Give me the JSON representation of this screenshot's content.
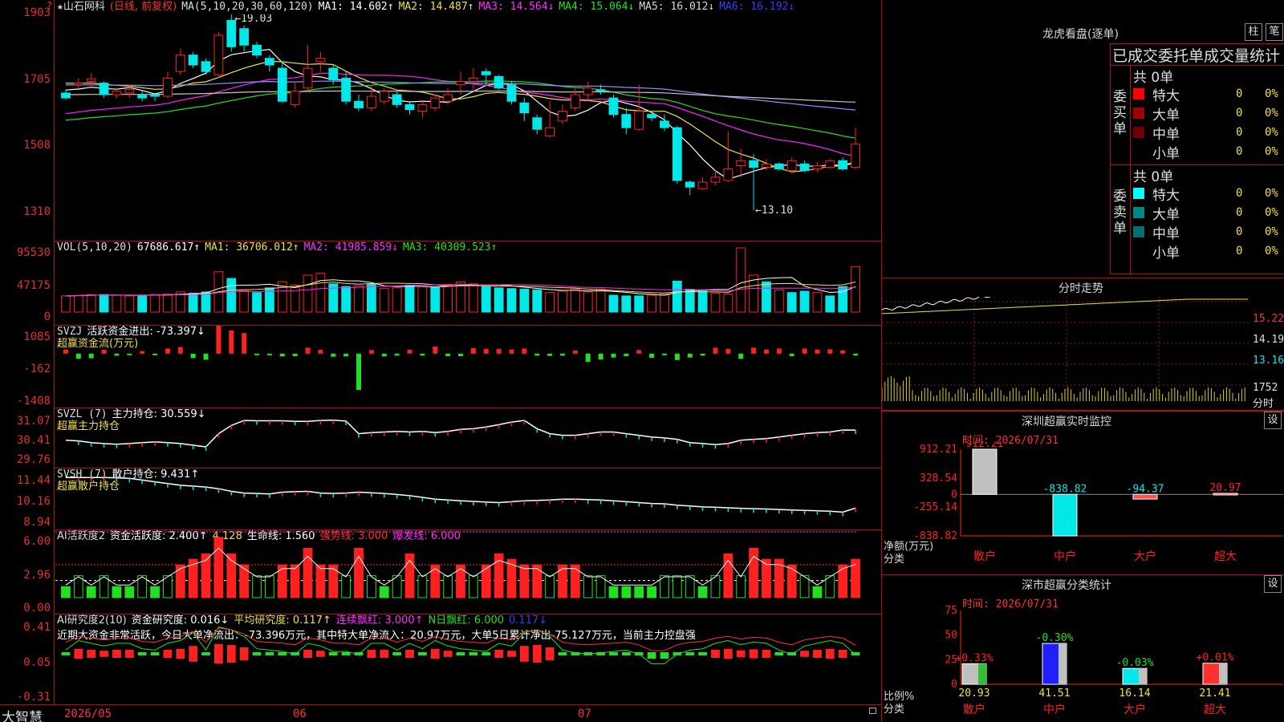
{
  "colors": {
    "up": "#ff2020",
    "down": "#00e8e8",
    "bg": "#000000",
    "border": "#b01010",
    "ma1": "#ffffff",
    "ma2": "#f0e040",
    "ma3": "#ff20ff",
    "ma4": "#20e020",
    "ma5": "#9090ff",
    "ma6": "#c8c8c8"
  },
  "header": {
    "star": "★",
    "stock_name": "山石网科",
    "period": "(日线, 前复权)",
    "ma_def": "MA(5,10,20,30,60,120)",
    "ma1": "MA1: 14.602↑",
    "ma2": "MA2: 14.487↑",
    "ma3": "MA3: 14.564↓",
    "ma4": "MA4: 15.064↓",
    "ma5": "MA5: 16.012↓",
    "ma6": "MA6: 16.192↓",
    "corner": "?"
  },
  "price_axis": {
    "ticks": [
      "1903",
      "1705",
      "1508",
      "1310"
    ],
    "high_label": "19.03",
    "low_label": "13.10"
  },
  "vol_panel": {
    "def": "VOL(5,10,20)",
    "vol": "67686.617↑",
    "ma1": "MA1: 36706.012↑",
    "ma2": "MA2: 41985.859↓",
    "ma3": "MA3: 40309.523↑",
    "ticks": [
      "95530",
      "47175",
      "0"
    ]
  },
  "svzj_panel": {
    "def": "SVZJ",
    "title": "活跃资金进出: -73.397↓",
    "sub": "超赢资金流(万元)",
    "ticks": [
      "1085",
      "-162",
      "-1408"
    ]
  },
  "svzl_panel": {
    "def": "SVZL (7)",
    "title": "主力持仓: 30.559↓",
    "sub": "超赢主力持仓",
    "ticks": [
      "31.07",
      "30.41",
      "29.76"
    ]
  },
  "svsh_panel": {
    "def": "SVSH (7)",
    "title": "散户持仓: 9.431↑",
    "sub": "超赢散户持仓",
    "ticks": [
      "11.44",
      "10.16",
      "8.94"
    ]
  },
  "ai_active_panel": {
    "def": "AI活跃度2",
    "active": "资金活跃度: 2.400↑",
    "v2": "4.128",
    "life": "生命线: 1.560",
    "strong": "强势线: 3.000",
    "burst": "爆发线: 6.000",
    "ticks": [
      "6.00",
      "2.96",
      "0.00"
    ]
  },
  "ai_research_panel": {
    "def": "AI研究度2(10)",
    "research": "资金研究度: 0.016↓",
    "avg": "平均研究度: 0.117↑",
    "red": "连续飘红: 3.000↑",
    "nred": "N日飘红: 6.000",
    "last": "0.117↓",
    "comment": "近期大资金非常活跃，今日大单净流出：-73.396万元，其中特大单净流入：20.97万元，大单5日累计净出-75.127万元，当前主力控盘强",
    "ticks": [
      "0.41",
      "0.05",
      "-0.31"
    ]
  },
  "footer": {
    "brand": "大智慧",
    "date_labels": [
      "2026/05",
      "06",
      "07"
    ]
  },
  "longhu": {
    "title": "龙虎看盘(逐单)",
    "btn_bar": "柱",
    "btn_stroke": "笔",
    "tab_line": "已成交委托单成交量统计",
    "buy_label": "委买单",
    "sell_label": "委卖单",
    "buy_total": "共 0单",
    "sell_total": "共 0单",
    "buy_rows": [
      {
        "name": "特大",
        "val": "0",
        "pct": "0%",
        "color": "#ff0000"
      },
      {
        "name": "大单",
        "val": "0",
        "pct": "0%",
        "color": "#a00000"
      },
      {
        "name": "中单",
        "val": "0",
        "pct": "0%",
        "color": "#700000"
      },
      {
        "name": "小单",
        "val": "0",
        "pct": "0%",
        "color": ""
      }
    ],
    "sell_rows": [
      {
        "name": "特大",
        "val": "0",
        "pct": "0%",
        "color": "#00ffff"
      },
      {
        "name": "大单",
        "val": "0",
        "pct": "0%",
        "color": "#008888"
      },
      {
        "name": "中单",
        "val": "0",
        "pct": "0%",
        "color": "#007070"
      },
      {
        "name": "小单",
        "val": "0",
        "pct": "0%",
        "color": ""
      }
    ]
  },
  "fenshi": {
    "title": "分时走势",
    "ticks": [
      "15.22",
      "14.19",
      "13.16",
      "1752",
      "分时"
    ]
  },
  "sz_monitor": {
    "title": "深圳超赢实时监控",
    "btn": "设",
    "time": "时间: 2026/07/31",
    "ticks": [
      "912.21",
      "328.54",
      "0",
      "-255.14",
      "-838.82"
    ],
    "ylabel1": "净额(万元)",
    "ylabel2": "分类",
    "cats": [
      "散户",
      "中户",
      "大户",
      "超大"
    ],
    "values": [
      912.21,
      -838.82,
      -94.37,
      20.97
    ],
    "value_labels": [
      "912.21",
      "-838.82",
      "-94.37",
      "20.97"
    ]
  },
  "sz_class": {
    "title": "深市超赢分类统计",
    "btn": "设",
    "time": "时间: 2026/07/31",
    "ticks": [
      "75",
      "50",
      "25",
      "0"
    ],
    "ylabel1": "比例%",
    "ylabel2": "分类",
    "cats": [
      "散户",
      "中户",
      "大户",
      "超大"
    ],
    "values": [
      20.93,
      41.51,
      16.14,
      21.41
    ],
    "value_labels": [
      "20.93",
      "41.51",
      "16.14",
      "21.41"
    ],
    "change_labels": [
      "+0.33%",
      "-0.30%",
      "-0.03%",
      "+0.01%"
    ]
  },
  "chart_data": {
    "type": "candlestick",
    "title": "山石网科 日线",
    "ylim": [
      13.1,
      19.03
    ],
    "candles": [
      [
        16.65,
        16.5,
        16.75,
        16.45
      ],
      [
        16.9,
        16.95,
        17.1,
        16.8
      ],
      [
        17.0,
        17.08,
        17.25,
        16.85
      ],
      [
        16.95,
        16.6,
        17.0,
        16.5
      ],
      [
        16.6,
        16.7,
        16.8,
        16.5
      ],
      [
        16.65,
        16.75,
        16.9,
        16.5
      ],
      [
        16.6,
        16.5,
        16.7,
        16.4
      ],
      [
        16.6,
        16.55,
        16.65,
        16.4
      ],
      [
        16.55,
        17.1,
        17.3,
        16.5
      ],
      [
        17.3,
        17.8,
        18.0,
        17.2
      ],
      [
        17.8,
        17.5,
        17.9,
        17.4
      ],
      [
        17.6,
        17.3,
        17.7,
        17.2
      ],
      [
        17.2,
        18.4,
        18.5,
        17.1
      ],
      [
        18.85,
        18.05,
        19.03,
        17.9
      ],
      [
        18.6,
        18.1,
        18.7,
        17.9
      ],
      [
        18.1,
        17.8,
        18.2,
        17.7
      ],
      [
        17.7,
        17.5,
        17.8,
        17.3
      ],
      [
        17.4,
        16.4,
        17.6,
        16.35
      ],
      [
        16.3,
        16.7,
        17.0,
        16.2
      ],
      [
        16.8,
        17.4,
        18.1,
        16.7
      ],
      [
        17.6,
        17.7,
        17.9,
        17.3
      ],
      [
        17.4,
        17.05,
        17.5,
        16.9
      ],
      [
        17.1,
        16.4,
        17.3,
        16.3
      ],
      [
        16.4,
        16.2,
        16.6,
        16.1
      ],
      [
        16.2,
        16.55,
        16.9,
        16.1
      ],
      [
        16.4,
        16.7,
        16.8,
        16.3
      ],
      [
        16.6,
        16.3,
        16.7,
        16.2
      ],
      [
        16.3,
        16.15,
        16.4,
        16.0
      ],
      [
        16.1,
        16.3,
        16.4,
        15.9
      ],
      [
        16.2,
        16.5,
        16.6,
        16.1
      ],
      [
        16.4,
        16.6,
        16.8,
        16.3
      ],
      [
        16.9,
        17.0,
        17.3,
        16.6
      ],
      [
        17.0,
        17.1,
        17.4,
        16.7
      ],
      [
        17.3,
        17.2,
        17.4,
        16.9
      ],
      [
        17.15,
        16.8,
        17.2,
        16.75
      ],
      [
        16.9,
        16.4,
        17.0,
        16.3
      ],
      [
        16.35,
        16.05,
        16.5,
        15.8
      ],
      [
        15.9,
        15.55,
        16.0,
        15.4
      ],
      [
        15.35,
        15.6,
        16.4,
        15.3
      ],
      [
        15.8,
        16.1,
        16.3,
        15.7
      ],
      [
        16.2,
        16.6,
        16.8,
        16.1
      ],
      [
        16.6,
        16.8,
        17.0,
        16.4
      ],
      [
        16.75,
        16.7,
        16.9,
        16.6
      ],
      [
        16.5,
        16.0,
        16.6,
        15.9
      ],
      [
        16.0,
        15.6,
        16.2,
        15.4
      ],
      [
        15.55,
        16.1,
        16.9,
        15.5
      ],
      [
        16.0,
        15.9,
        16.1,
        15.8
      ],
      [
        15.8,
        15.6,
        16.0,
        15.5
      ],
      [
        15.6,
        14.0,
        15.65,
        13.9
      ],
      [
        13.95,
        13.8,
        14.0,
        13.55
      ],
      [
        13.75,
        13.95,
        14.1,
        13.7
      ],
      [
        13.95,
        14.1,
        14.3,
        13.85
      ],
      [
        14.0,
        14.35,
        15.5,
        13.95
      ],
      [
        14.45,
        14.6,
        14.95,
        14.1
      ],
      [
        14.6,
        14.4,
        14.8,
        13.1
      ],
      [
        14.4,
        14.5,
        14.65,
        14.3
      ],
      [
        14.5,
        14.35,
        14.55,
        14.3
      ],
      [
        14.3,
        14.6,
        14.7,
        14.2
      ],
      [
        14.5,
        14.3,
        14.6,
        14.25
      ],
      [
        14.35,
        14.45,
        14.55,
        14.25
      ],
      [
        14.4,
        14.6,
        14.65,
        14.35
      ],
      [
        14.6,
        14.35,
        14.7,
        14.3
      ],
      [
        14.4,
        15.1,
        15.6,
        14.35
      ]
    ],
    "volume": [
      [
        24000,
        "up"
      ],
      [
        25000,
        "up"
      ],
      [
        26000,
        "up"
      ],
      [
        26000,
        "down"
      ],
      [
        25000,
        "up"
      ],
      [
        24000,
        "up"
      ],
      [
        25000,
        "down"
      ],
      [
        26000,
        "up"
      ],
      [
        27000,
        "up"
      ],
      [
        30000,
        "up"
      ],
      [
        28000,
        "down"
      ],
      [
        30000,
        "down"
      ],
      [
        60000,
        "up"
      ],
      [
        50000,
        "down"
      ],
      [
        32000,
        "up"
      ],
      [
        29000,
        "down"
      ],
      [
        36000,
        "down"
      ],
      [
        45000,
        "up"
      ],
      [
        40000,
        "up"
      ],
      [
        55000,
        "up"
      ],
      [
        58000,
        "up"
      ],
      [
        42000,
        "down"
      ],
      [
        38000,
        "down"
      ],
      [
        39000,
        "up"
      ],
      [
        42000,
        "down"
      ],
      [
        35000,
        "up"
      ],
      [
        36000,
        "up"
      ],
      [
        40000,
        "down"
      ],
      [
        38000,
        "up"
      ],
      [
        37000,
        "down"
      ],
      [
        40000,
        "up"
      ],
      [
        45000,
        "up"
      ],
      [
        42000,
        "up"
      ],
      [
        38000,
        "down"
      ],
      [
        36000,
        "down"
      ],
      [
        35000,
        "down"
      ],
      [
        34000,
        "down"
      ],
      [
        33000,
        "down"
      ],
      [
        29000,
        "up"
      ],
      [
        31000,
        "up"
      ],
      [
        34000,
        "up"
      ],
      [
        30000,
        "up"
      ],
      [
        34000,
        "up"
      ],
      [
        25000,
        "down"
      ],
      [
        24000,
        "down"
      ],
      [
        24000,
        "down"
      ],
      [
        25000,
        "up"
      ],
      [
        27000,
        "up"
      ],
      [
        46000,
        "down"
      ],
      [
        34000,
        "down"
      ],
      [
        33000,
        "down"
      ],
      [
        28000,
        "up"
      ],
      [
        27000,
        "up"
      ],
      [
        95530,
        "up"
      ],
      [
        55000,
        "up"
      ],
      [
        45000,
        "down"
      ],
      [
        33000,
        "up"
      ],
      [
        29000,
        "down"
      ],
      [
        31000,
        "down"
      ],
      [
        29000,
        "up"
      ],
      [
        24000,
        "down"
      ],
      [
        38000,
        "down"
      ],
      [
        67686,
        "up"
      ]
    ],
    "svzj": [
      162,
      -200,
      -180,
      150,
      -80,
      -60,
      100,
      -60,
      200,
      260,
      -170,
      -240,
      1085,
      900,
      800,
      -40,
      -40,
      -110,
      -100,
      230,
      150,
      -120,
      -110,
      -1408,
      140,
      -110,
      -80,
      150,
      -80,
      280,
      -100,
      -100,
      220,
      190,
      180,
      160,
      200,
      -80,
      -90,
      -80,
      120,
      -320,
      -230,
      -150,
      -100,
      140,
      -160,
      -60,
      -250,
      -150,
      -80,
      230,
      180,
      -200,
      230,
      160,
      200,
      -100,
      200,
      160,
      170,
      130,
      -73.397
    ],
    "svzl": [
      30.25,
      30.23,
      30.18,
      30.15,
      30.13,
      30.15,
      30.18,
      30.2,
      30.18,
      30.15,
      30.1,
      30.05,
      30.45,
      30.7,
      30.85,
      30.84,
      30.84,
      30.84,
      30.82,
      30.82,
      30.85,
      30.86,
      30.83,
      30.45,
      30.48,
      30.5,
      30.52,
      30.5,
      30.52,
      30.48,
      30.52,
      30.58,
      30.6,
      30.65,
      30.72,
      30.8,
      30.85,
      30.6,
      30.45,
      30.4,
      30.4,
      30.45,
      30.5,
      30.5,
      30.45,
      30.4,
      30.35,
      30.32,
      30.28,
      30.18,
      30.15,
      30.12,
      30.15,
      30.25,
      30.28,
      30.3,
      30.35,
      30.4,
      30.45,
      30.48,
      30.5,
      30.56,
      30.559
    ],
    "svsh": [
      11.2,
      11.2,
      11.2,
      11.2,
      11.18,
      11.15,
      11.05,
      10.95,
      10.85,
      10.75,
      10.7,
      10.65,
      10.55,
      10.4,
      10.3,
      10.28,
      10.25,
      10.35,
      10.38,
      10.4,
      10.3,
      10.28,
      10.3,
      10.35,
      10.32,
      10.28,
      10.22,
      10.15,
      10.05,
      9.95,
      9.9,
      9.85,
      9.82,
      9.78,
      9.75,
      9.8,
      9.85,
      9.88,
      9.9,
      9.95,
      9.95,
      9.92,
      9.9,
      9.85,
      9.8,
      9.75,
      9.7,
      9.68,
      9.6,
      9.55,
      9.5,
      9.48,
      9.45,
      9.42,
      9.4,
      9.38,
      9.35,
      9.32,
      9.3,
      9.28,
      9.25,
      9.2,
      9.431
    ],
    "ai_active": [
      1,
      2,
      1,
      2,
      1,
      1,
      2,
      1,
      2,
      3,
      3.5,
      4.0,
      5.5,
      4,
      3,
      2,
      2,
      3,
      3,
      4.5,
      3,
      3,
      2,
      4.5,
      2,
      1,
      2,
      4,
      2,
      3,
      2,
      3,
      2,
      3,
      4,
      3.5,
      3,
      3,
      2,
      3,
      3,
      2,
      2,
      1,
      1,
      1,
      1,
      2,
      2,
      2,
      1,
      2,
      4,
      2,
      4.5,
      3.5,
      3.5,
      3,
      2,
      1,
      2,
      3,
      3.5
    ],
    "ai_research": [
      0.05,
      0.12,
      0.1,
      0.08,
      0.1,
      0.1,
      0.06,
      0.05,
      0.1,
      0.12,
      0.18,
      0.05,
      0.22,
      0.2,
      0.15,
      0.06,
      0.05,
      0.04,
      0.02,
      0.1,
      0.08,
      0.04,
      0.04,
      0.02,
      0.1,
      0.1,
      0.05,
      0.1,
      0.06,
      0.12,
      0.08,
      0.06,
      0.05,
      0.04,
      0.1,
      0.08,
      0.18,
      0.2,
      0.15,
      0.05,
      0.03,
      0.02,
      0.03,
      0.04,
      0.05,
      0.02,
      -0.05,
      -0.05,
      0.02,
      0.05,
      0.06,
      0.1,
      0.12,
      0.09,
      0.11,
      0.1,
      0.05,
      0.02,
      0.08,
      0.1,
      0.12,
      0.1,
      0.016
    ]
  }
}
